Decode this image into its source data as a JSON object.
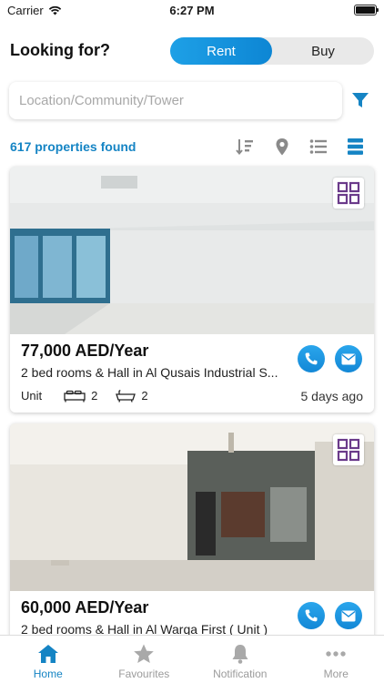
{
  "status_bar": {
    "carrier": "Carrier",
    "time": "6:27 PM"
  },
  "header": {
    "title": "Looking for?"
  },
  "mode_toggle": {
    "options": [
      "Rent",
      "Buy"
    ],
    "selected": "Rent"
  },
  "search": {
    "placeholder": "Location/Community/Tower",
    "value": ""
  },
  "results": {
    "count_text": "617 properties found"
  },
  "toolbar": {
    "icons": [
      "sort-icon",
      "map-pin-icon",
      "list-view-icon",
      "card-view-icon"
    ],
    "active": "card-view-icon"
  },
  "listings": [
    {
      "price": "77,000 AED/Year",
      "title": "2 bed rooms & Hall in Al Qusais Industrial S...",
      "type": "Unit",
      "beds": "2",
      "baths": "2",
      "date": "5 days ago"
    },
    {
      "price": "60,000 AED/Year",
      "title": "2 bed rooms & Hall in Al Warqa First ( Unit )",
      "type": "",
      "beds": "",
      "baths": "",
      "date": ""
    }
  ],
  "tab_bar": {
    "tabs": [
      {
        "label": "Home",
        "icon": "home-icon",
        "active": true
      },
      {
        "label": "Favourites",
        "icon": "star-icon",
        "active": false
      },
      {
        "label": "Notification",
        "icon": "bell-icon",
        "active": false
      },
      {
        "label": "More",
        "icon": "more-dots-icon",
        "active": false
      }
    ]
  },
  "colors": {
    "accent": "#1584c4",
    "button_gradient_start": "#1ea0e6",
    "inactive_tab": "#9b9b9b"
  }
}
